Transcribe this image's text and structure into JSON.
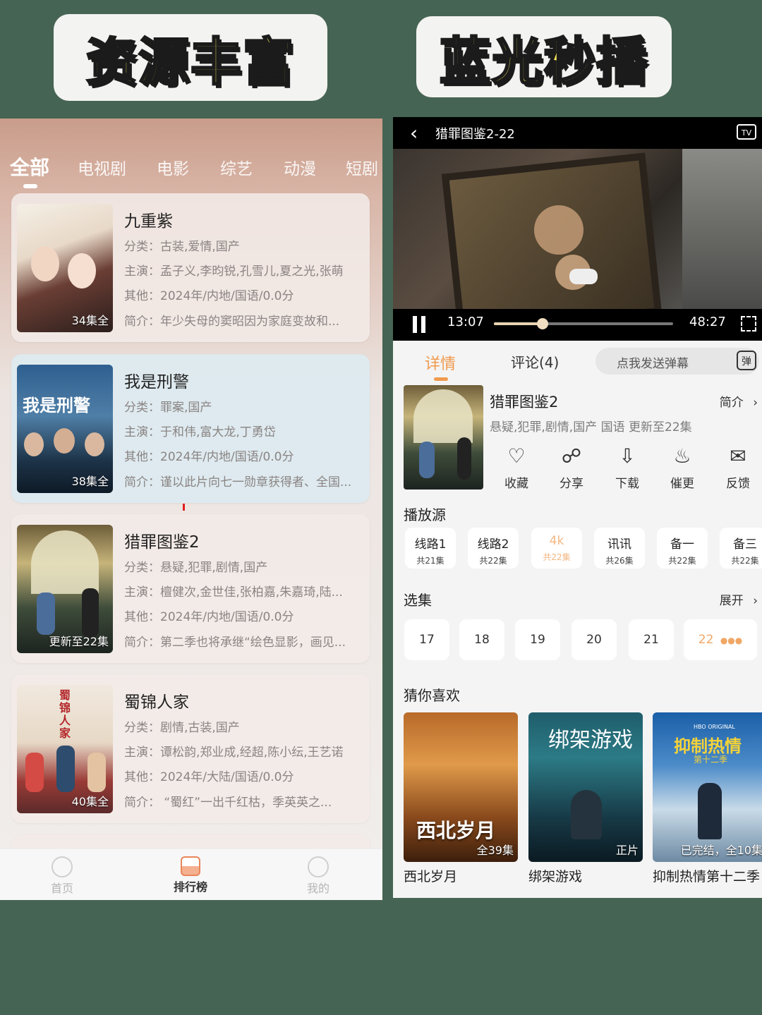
{
  "banners": {
    "left": "资源丰富",
    "right": "蓝光秒播"
  },
  "left": {
    "tabs": [
      {
        "label": "全部"
      },
      {
        "label": "电视剧"
      },
      {
        "label": "电影"
      },
      {
        "label": "综艺"
      },
      {
        "label": "动漫"
      },
      {
        "label": "短剧"
      }
    ],
    "cards": [
      {
        "title": "九重紫",
        "category": "分类：古装,爱情,国产",
        "cast": "主演：孟子义,李昀锐,孔雪儿,夏之光,张萌",
        "other": "其他：2024年/内地/国语/0.0分",
        "intro": "简介：年少失母的窦昭因为家庭变故和...",
        "badge": "34集全"
      },
      {
        "title": "我是刑警",
        "category": "分类：罪案,国产",
        "cast": "主演：于和伟,富大龙,丁勇岱",
        "other": "其他：2024年/内地/国语/0.0分",
        "intro": "简介：谨以此片向七一勋章获得者、全国...",
        "badge": "38集全",
        "poster_text": "我是刑警"
      },
      {
        "title": "猎罪图鉴2",
        "category": "分类：悬疑,犯罪,剧情,国产",
        "cast": "主演：檀健次,金世佳,张柏嘉,朱嘉琦,陆...",
        "other": "其他：2024年/内地/国语/0.0分",
        "intro": "简介：第二季也将承继“绘色显影，画见...",
        "badge": "更新至22集"
      },
      {
        "title": "蜀锦人家",
        "category": "分类：剧情,古装,国产",
        "cast": "主演：谭松韵,郑业成,经超,陈小纭,王艺诺",
        "other": "其他：2024年/大陆/国语/0.0分",
        "intro": "简介：    “蜀红”一出千红枯，季英英之...",
        "badge": "40集全",
        "poster_text": "蜀锦人家"
      }
    ],
    "nav": [
      {
        "label": "首页"
      },
      {
        "label": "排行榜"
      },
      {
        "label": "我的"
      }
    ]
  },
  "right": {
    "player": {
      "title": "猎罪图鉴2-22",
      "current_time": "13:07",
      "total_time": "48:27",
      "progress": 0.27,
      "tv_label": "TV"
    },
    "detail_tabs": [
      {
        "label": "详情"
      },
      {
        "label": "评论(4)"
      }
    ],
    "danmaku": {
      "placeholder": "点我发送弹幕",
      "icon_text": "弹"
    },
    "info": {
      "title": "猎罪图鉴2",
      "intro_link": "简介",
      "meta": "悬疑,犯罪,剧情,国产 国语 更新至22集"
    },
    "actions": [
      {
        "label": "收藏",
        "icon": "heart-icon"
      },
      {
        "label": "分享",
        "icon": "share-icon"
      },
      {
        "label": "下载",
        "icon": "download-icon"
      },
      {
        "label": "催更",
        "icon": "bell-icon"
      },
      {
        "label": "反馈",
        "icon": "feedback-icon"
      }
    ],
    "sources_title": "播放源",
    "sources": [
      {
        "name": "线路1",
        "count": "共21集"
      },
      {
        "name": "线路2",
        "count": "共22集"
      },
      {
        "name": "4k",
        "count": "共22集"
      },
      {
        "name": "讯讯",
        "count": "共26集"
      },
      {
        "name": "备一",
        "count": "共22集"
      },
      {
        "name": "备三",
        "count": "共22集"
      }
    ],
    "episodes_title": "选集",
    "episodes_expand": "展开",
    "episodes": [
      "17",
      "18",
      "19",
      "20",
      "21",
      "22"
    ],
    "recommend_title": "猜你喜欢",
    "recommend": [
      {
        "title": "西北岁月",
        "badge": "全39集",
        "poster_text": "西北岁月"
      },
      {
        "title": "绑架游戏",
        "badge": "正片",
        "poster_text": "绑架游戏"
      },
      {
        "title": "抑制热情第十二季",
        "badge": "已完结，全10集",
        "poster_text": "抑制热情",
        "poster_sub": "第十二季",
        "poster_brand": "HBO ORIGINAL"
      }
    ]
  },
  "colors": {
    "background": "#466453",
    "accent_orange": "#f09a4e",
    "banner_text": "#f3e35a"
  }
}
